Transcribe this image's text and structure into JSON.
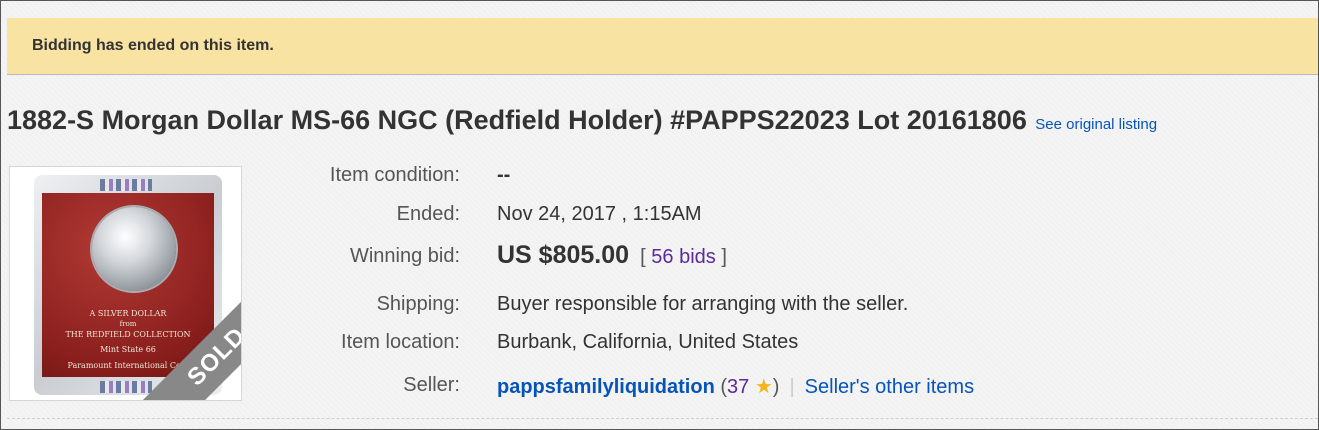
{
  "alert": {
    "message": "Bidding has ended on this item."
  },
  "listing": {
    "title": "1882-S Morgan Dollar MS-66 NGC (Redfield Holder) #PAPPS22023 Lot 20161806",
    "original_link": "See original listing"
  },
  "photo": {
    "badge": "SOLD",
    "card_line1": "A SILVER DOLLAR",
    "card_line2": "from",
    "card_line3": "THE REDFIELD COLLECTION",
    "card_line4": "Mint State 66",
    "card_line5": "Paramount International Coin"
  },
  "details": {
    "condition_label": "Item condition:",
    "condition_value": "--",
    "ended_label": "Ended:",
    "ended_date": "Nov 24, 2017",
    "ended_sep": " , ",
    "ended_time": "1:15AM",
    "bid_label": "Winning bid:",
    "bid_value": "US $805.00",
    "bids_open": "[",
    "bids_count": "56 bids",
    "bids_close": "]",
    "shipping_label": "Shipping:",
    "shipping_value": "Buyer responsible for arranging with the seller.",
    "location_label": "Item location:",
    "location_value": "Burbank, California, United States",
    "seller_label": "Seller:",
    "seller_name": "pappsfamilyliquidation",
    "feedback_open": "(",
    "feedback_score": "37",
    "feedback_close": ")",
    "separator": "|",
    "other_items": "Seller's other items"
  },
  "colors": {
    "alert_bg": "#f8e3a3",
    "link_blue": "#0654ba",
    "visited_purple": "#5b2a9a",
    "star_gold": "#f3b51b",
    "sold_ribbon": "#888888"
  },
  "icons": {
    "feedback_star": "star-icon"
  }
}
